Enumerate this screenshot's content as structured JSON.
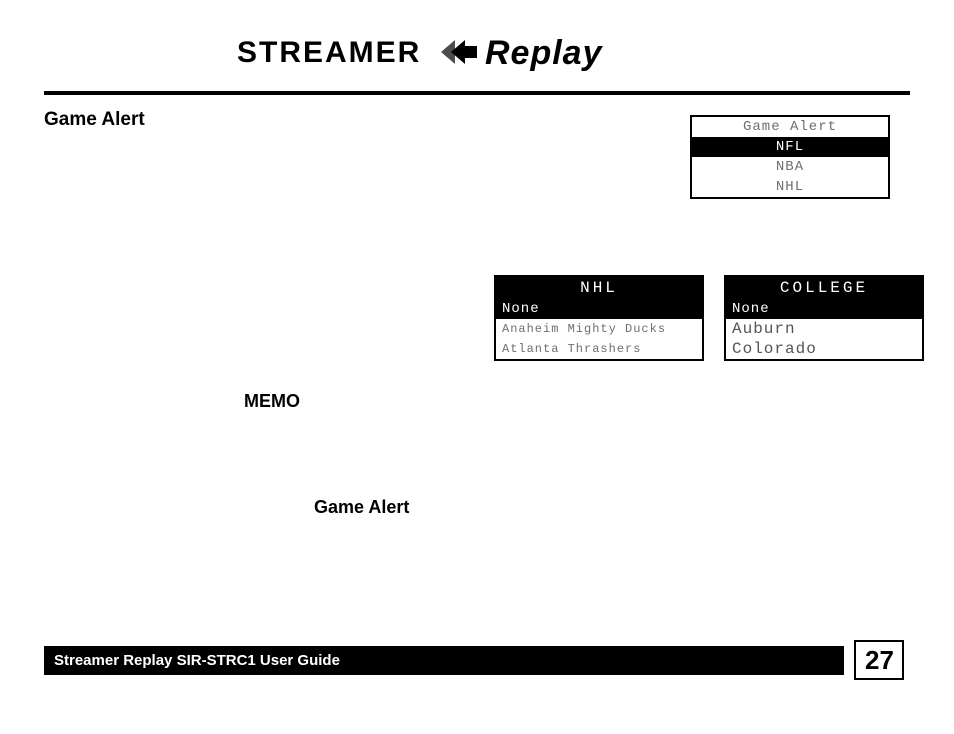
{
  "header": {
    "logo_left": "STREAMER",
    "logo_right": "Replay"
  },
  "section_title": "Game Alert",
  "memo_label": "MEMO",
  "ga_label": "Game Alert",
  "lcd1": {
    "title": "Game Alert",
    "rows": [
      "NFL",
      "NBA",
      "NHL"
    ],
    "selected_index": 0
  },
  "lcd2": {
    "title": "NHL",
    "rows": [
      "None",
      "Anaheim Mighty Ducks",
      "Atlanta Thrashers"
    ],
    "selected_index": 0
  },
  "lcd3": {
    "title": "COLLEGE",
    "rows": [
      "None",
      "Auburn",
      "Colorado"
    ],
    "selected_index": 0
  },
  "footer": {
    "text": "Streamer Replay SIR-STRC1 User Guide",
    "page": "27"
  }
}
